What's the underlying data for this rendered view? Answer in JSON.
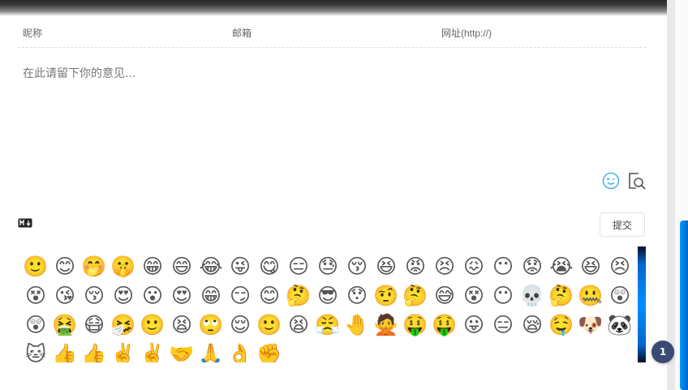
{
  "comment_form": {
    "nickname_placeholder": "昵称",
    "email_placeholder": "邮箱",
    "link_placeholder": "网址(http://)",
    "content_placeholder": "在此请留下你的意见...",
    "emoji_toggle_icon": "emoji-icon",
    "preview_toggle_icon": "preview-icon",
    "markdown_icon": "markdown-icon",
    "submit_label": "提交"
  },
  "emoji_panel": {
    "emojis": [
      "🙂",
      "😊",
      "🤭",
      "🤫",
      "😁",
      "😄",
      "😂",
      "😜",
      "😋",
      "😑",
      "😓",
      "😚",
      "😆",
      "😡",
      "😣",
      "😖",
      "😶",
      "😟",
      "😭",
      "😆",
      "😣",
      "😵",
      "😘",
      "😚",
      "😍",
      "😮",
      "😍",
      "😁",
      "😏",
      "😊",
      "🤔",
      "😎",
      "😯",
      "🤨",
      "🤔",
      "😅",
      "😵",
      "😶",
      "💀",
      "🤔",
      "🤐",
      "😲",
      "😲",
      "🤮",
      "😷",
      "🤧",
      "🙂",
      "😫",
      "🙄",
      "😌",
      "🙂",
      "😫",
      "😤",
      "🤚",
      "🙅",
      "🤑",
      "🤑",
      "😛",
      "😑",
      "😪",
      "🤤",
      "🐶",
      "🐼",
      "🐱",
      "👍",
      "👍",
      "✌️",
      "✌️",
      "🤝",
      "🙏",
      "👌",
      "✊"
    ],
    "colors": {
      "scroll_accent": "#0090ff"
    }
  },
  "page": {
    "unread_count": "1",
    "colors": {
      "badge": "#3a4a73",
      "accent": "#1e90ff"
    }
  }
}
